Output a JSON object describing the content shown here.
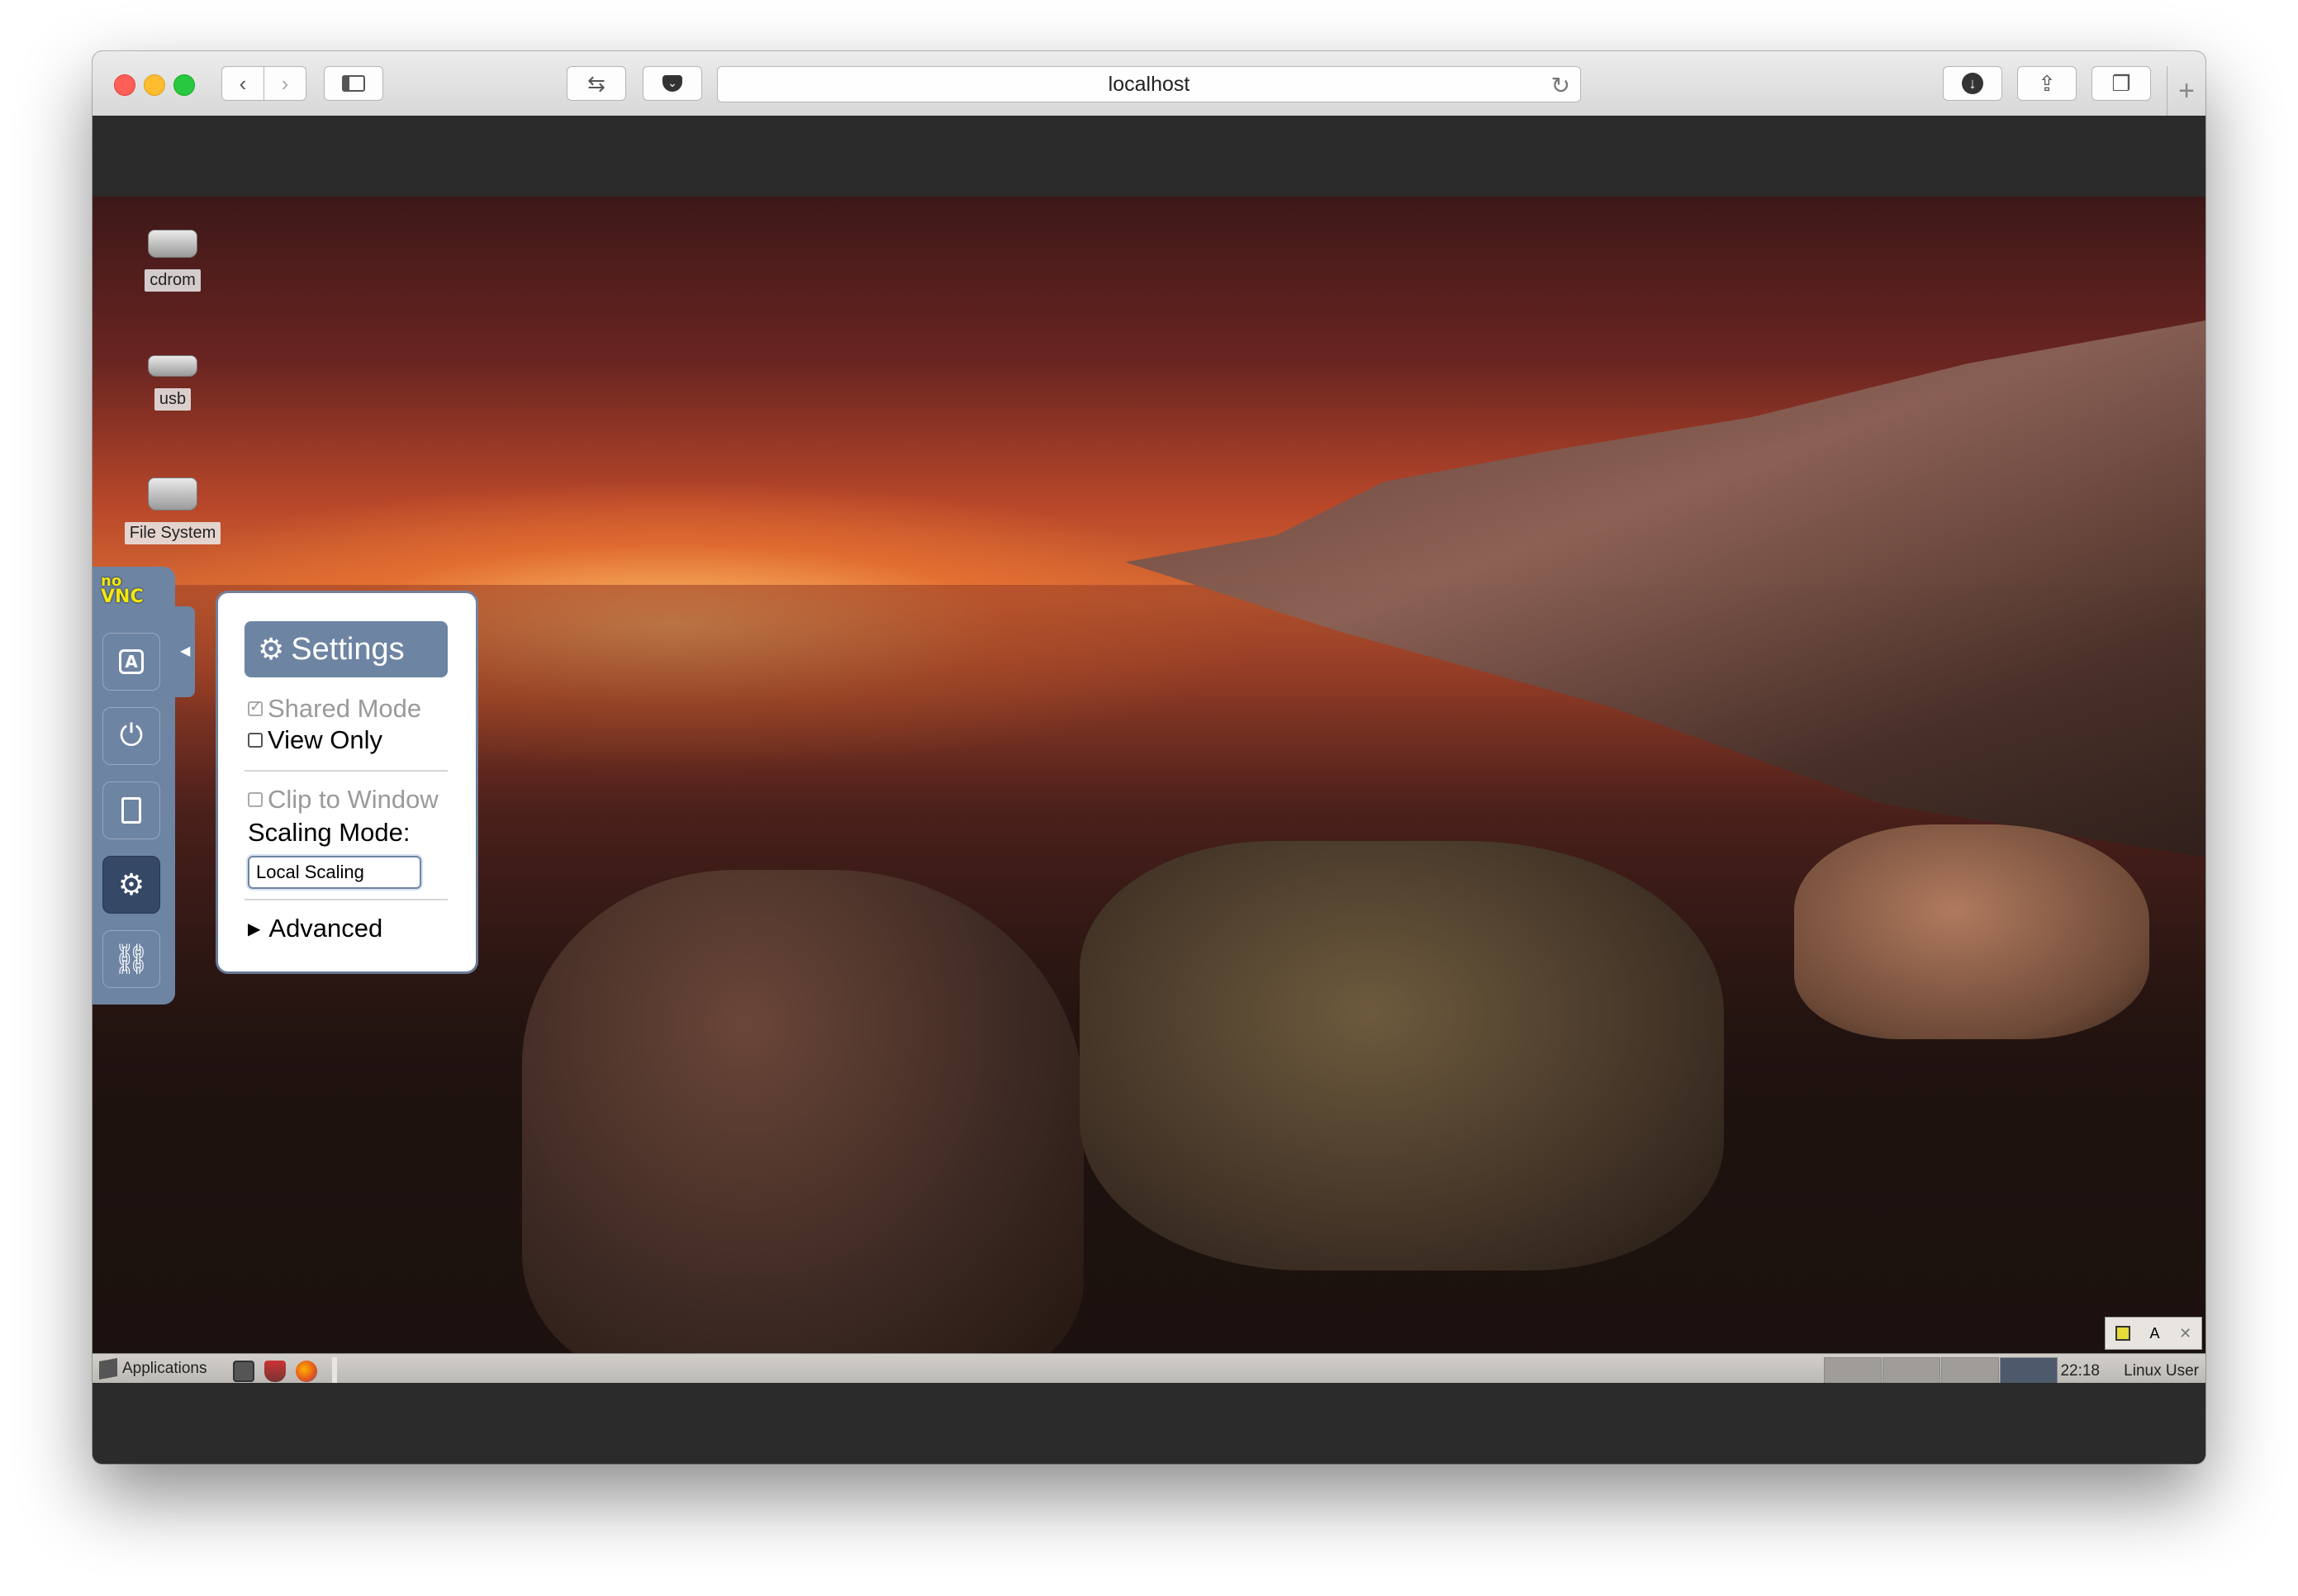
{
  "browser": {
    "url": "localhost",
    "back_icon": "chevron-left",
    "forward_icon": "chevron-right",
    "sidebar_icon": "sidebar",
    "reload_icon": "reload",
    "download_icon": "download",
    "share_icon": "share",
    "tabs_icon": "tabs",
    "new_tab_icon": "plus"
  },
  "desktop_icons": [
    {
      "label": "cdrom"
    },
    {
      "label": "usb"
    },
    {
      "label": "File System"
    }
  ],
  "novnc": {
    "logo_top": "no",
    "logo_bottom": "VNC",
    "buttons": [
      {
        "name": "keyboard",
        "glyph": "A"
      },
      {
        "name": "power",
        "glyph": "⏻"
      },
      {
        "name": "clipboard",
        "glyph": "📋"
      },
      {
        "name": "settings",
        "glyph": "⚙",
        "selected": true
      },
      {
        "name": "disconnect",
        "glyph": "⛓"
      }
    ]
  },
  "settings_panel": {
    "title": "Settings",
    "shared_mode": {
      "label": "Shared Mode",
      "checked": true,
      "disabled": true
    },
    "view_only": {
      "label": "View Only",
      "checked": false
    },
    "clip_to_window": {
      "label": "Clip to Window",
      "checked": false,
      "disabled": true
    },
    "scaling_mode_label": "Scaling Mode:",
    "scaling_mode_value": "Local Scaling",
    "advanced_label": "Advanced"
  },
  "taskbar": {
    "applications_label": "Applications",
    "clock": "22:18",
    "user": "Linux User",
    "workspaces": 4,
    "active_workspace": 4,
    "tray": {
      "keyboard_label": "A"
    }
  },
  "colors": {
    "novnc_accent": "#6e84a3",
    "novnc_selected": "#354866",
    "logo_yellow": "#f2e80a"
  }
}
